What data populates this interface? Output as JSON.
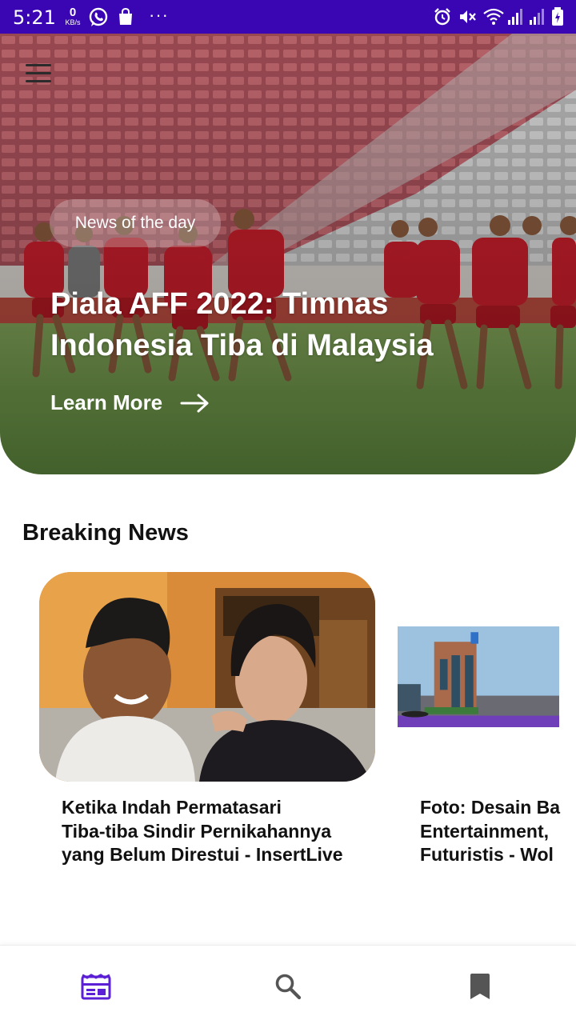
{
  "status_bar": {
    "time": "5:21",
    "net_speed_value": "0",
    "net_speed_unit": "KB/s",
    "more_indicator": "···"
  },
  "hero": {
    "tag": "News of the day",
    "title_lines": [
      "Piala AFF 2022: Timnas",
      "Indonesia Tiba di Malaysia"
    ],
    "cta_label": "Learn More"
  },
  "breaking_news": {
    "section_title": "Breaking News",
    "articles": [
      {
        "title_lines": [
          "Ketika Indah Permatasari",
          "Tiba-tiba Sindir Pernikahannya",
          "yang Belum Direstui - InsertLive"
        ]
      },
      {
        "title_lines": [
          "Foto: Desain Ba",
          "Entertainment, ",
          "Futuristis - Wol"
        ]
      }
    ]
  },
  "bottom_nav": {
    "items": [
      "news-feed-icon",
      "search-icon",
      "bookmark-icon"
    ],
    "active_index": 0
  },
  "colors": {
    "status_bar": "#3a06b3",
    "accent": "#5b1fd6",
    "nav_inactive": "#555555"
  }
}
